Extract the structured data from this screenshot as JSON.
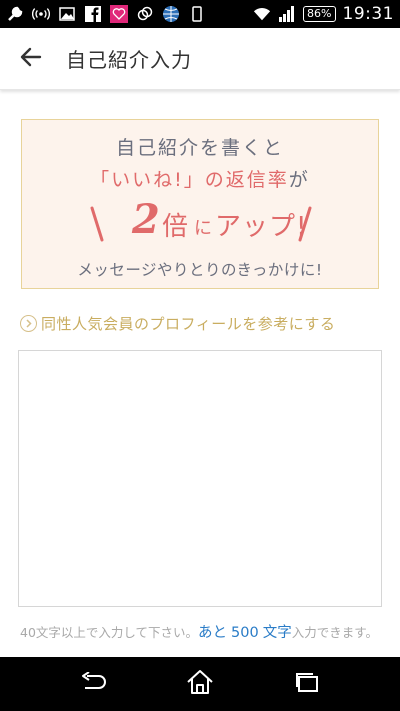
{
  "status_bar": {
    "battery": "86%",
    "time": "19:31",
    "icons": [
      "wrench-icon",
      "radio-waves-icon",
      "image-icon",
      "facebook-icon",
      "app-badge-icon",
      "link-icon",
      "globe-icon",
      "phone-icon",
      "wifi-icon",
      "signal-icon"
    ]
  },
  "app_bar": {
    "back_icon": "arrow-left-icon",
    "title": "自己紹介入力"
  },
  "banner": {
    "line1": "自己紹介を書くと",
    "line2_main": "「いいね!」の返信率",
    "line2_suffix": "が",
    "line3_number": "2",
    "line3_bai": "倍",
    "line3_ni": "に",
    "line3_up": "アップ!",
    "line4": "メッセージやりとりのきっかけに!",
    "colors": {
      "background": "#fdf3ec",
      "border": "#e8d39a",
      "accent": "#e06a6a",
      "text": "#6b6f7e"
    }
  },
  "reference_link": {
    "label": "同性人気会員のプロフィールを参考にする",
    "icon": "chevron-right-circle-icon",
    "color": "#c9ad60"
  },
  "textarea": {
    "value": "",
    "placeholder": ""
  },
  "hint": {
    "prefix": "40文字以上で入力して下さい。",
    "remaining_label": "あと",
    "remaining_count": "500",
    "remaining_unit": "文字",
    "suffix": "入力できます。"
  },
  "nav_bar": {
    "back_icon": "back-arrow-icon",
    "home_icon": "home-icon",
    "recents_icon": "recents-icon"
  }
}
